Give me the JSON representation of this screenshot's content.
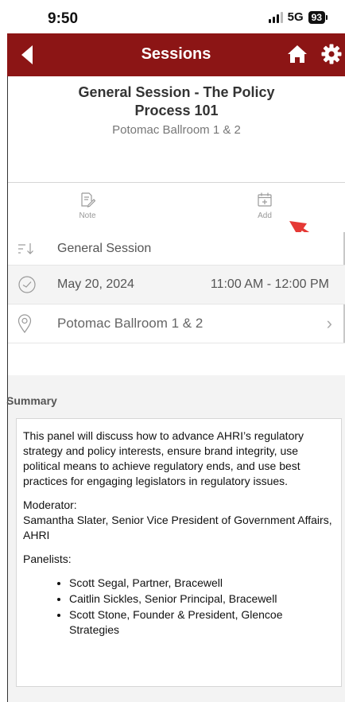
{
  "status_bar": {
    "time": "9:50",
    "network": "5G",
    "battery": "93"
  },
  "nav": {
    "title": "Sessions"
  },
  "session": {
    "title_line1": "General Session - The Policy",
    "title_line2": "Process 101",
    "location": "Potomac Ballroom 1 & 2"
  },
  "actions": {
    "note_label": "Note",
    "add_label": "Add"
  },
  "details": {
    "type": "General Session",
    "date": "May 20, 2024",
    "time_range": "11:00 AM - 12:00 PM",
    "location": "Potomac Ballroom 1 & 2"
  },
  "summary": {
    "heading": "Summary",
    "paragraph": "This panel will discuss how to advance AHRI’s regulatory strategy and policy interests, ensure brand integrity, use political means to achieve regulatory ends, and use best practices for engaging legislators in regulatory issues.",
    "moderator_label": "Moderator:",
    "moderator": "Samantha Slater, Senior Vice President of Government Affairs, AHRI",
    "panelists_label": "Panelists:",
    "panelists": [
      "Scott Segal, Partner, Bracewell",
      "Caitlin Sickles, Senior Principal, Bracewell",
      "Scott Stone, Founder & President, Glencoe Strategies"
    ]
  },
  "colors": {
    "brand": "#8c1515",
    "annotation_arrow": "#e53935"
  },
  "icons": {
    "back": "back-arrow-icon",
    "home": "home-icon",
    "settings": "gear-icon",
    "note": "note-icon",
    "add": "calendar-add-icon",
    "sort": "sort-icon",
    "clock": "clock-icon",
    "pin": "location-pin-icon",
    "chevron": "chevron-right-icon"
  }
}
